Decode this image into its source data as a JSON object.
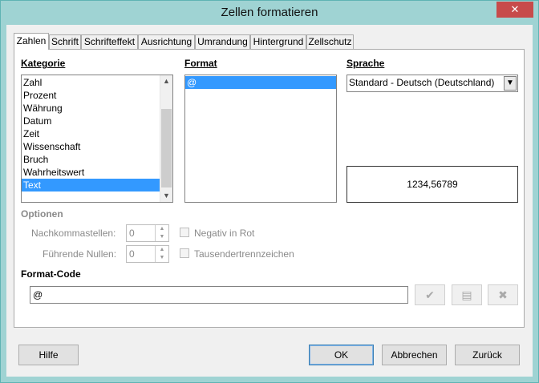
{
  "window": {
    "title": "Zellen formatieren",
    "close_glyph": "✕"
  },
  "tabs": [
    {
      "label": "Zahlen"
    },
    {
      "label": "Schrift"
    },
    {
      "label": "Schrifteffekt"
    },
    {
      "label": "Ausrichtung"
    },
    {
      "label": "Umrandung"
    },
    {
      "label": "Hintergrund"
    },
    {
      "label": "Zellschutz"
    }
  ],
  "kategorie": {
    "header": "Kategorie",
    "items": [
      "Zahl",
      "Prozent",
      "Währung",
      "Datum",
      "Zeit",
      "Wissenschaft",
      "Bruch",
      "Wahrheitswert",
      "Text"
    ],
    "selected": "Text"
  },
  "format": {
    "header": "Format",
    "items": [
      "@"
    ],
    "selected": "@"
  },
  "sprache": {
    "header": "Sprache",
    "value": "Standard - Deutsch (Deutschland)"
  },
  "preview": {
    "value": "1234,56789"
  },
  "optionen": {
    "header": "Optionen",
    "nachkommastellen_label": "Nachkommastellen:",
    "nachkommastellen_value": "0",
    "fuehrende_nullen_label": "Führende Nullen:",
    "fuehrende_nullen_value": "0",
    "negativ_label": "Negativ in Rot",
    "tausender_label": "Tausendertrennzeichen"
  },
  "format_code": {
    "header": "Format-Code",
    "value": "@"
  },
  "buttons": {
    "hilfe": "Hilfe",
    "ok": "OK",
    "abbrechen": "Abbrechen",
    "zurueck": "Zurück"
  },
  "icons": {
    "check": "✔",
    "comment": "▤",
    "delete": "✖"
  }
}
